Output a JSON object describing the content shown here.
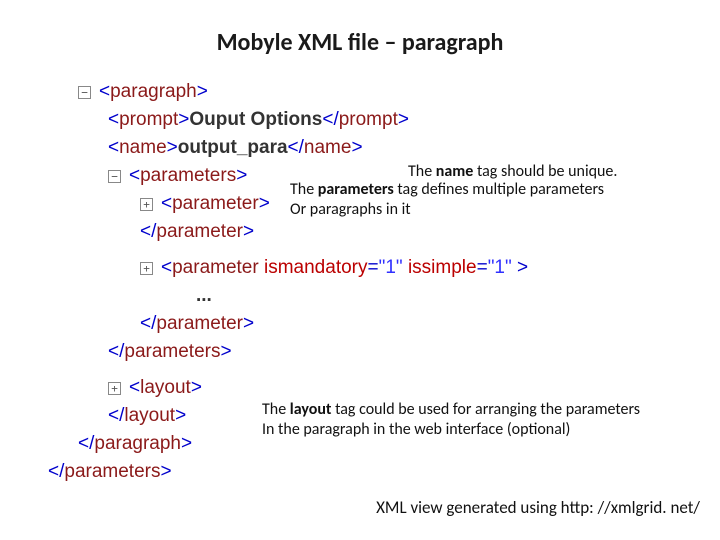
{
  "title": "Mobyle XML file – paragraph",
  "xml": {
    "open_paragraph_tag": "paragraph",
    "prompt_tag": "prompt",
    "prompt_text": "Ouput Options",
    "name_tag": "name",
    "name_text": "output_para",
    "parameters_tag": "parameters",
    "parameter_tag": "parameter",
    "parameter2_attrs": {
      "attr1": "ismandatory",
      "val1": "\"1\"",
      "attr2": "issimple",
      "val2": "\"1\""
    },
    "ellipsis": "...",
    "layout_tag": "layout",
    "close_paragraph_tag": "paragraph",
    "close_outer_parameters_tag": "parameters"
  },
  "boxes": {
    "minus": "−",
    "plus": "+"
  },
  "notes": {
    "n1_pre": "The ",
    "n1_b": "name",
    "n1_post": " tag should be unique.",
    "n2_pre": "The ",
    "n2_b": "parameters",
    "n2_post": " tag defines multiple parameters",
    "n2_line2": "Or paragraphs in it",
    "n3_pre": "The ",
    "n3_b": "layout",
    "n3_post": " tag could be used for arranging the parameters",
    "n3_line2": "In the paragraph in the web interface (optional)"
  },
  "footer": "XML view generated using http: //xmlgrid. net/"
}
